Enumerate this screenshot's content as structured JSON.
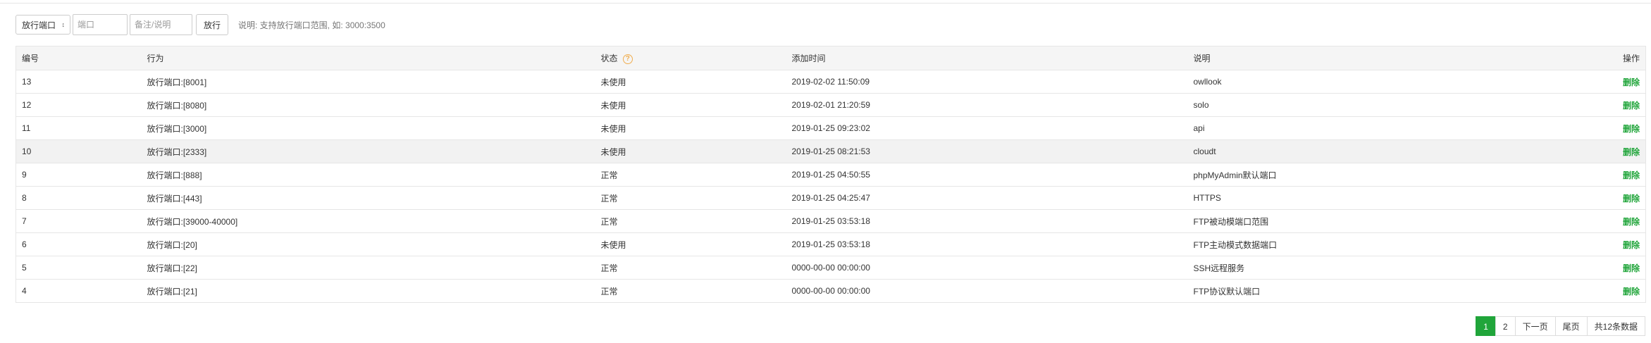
{
  "toolbar": {
    "select_value": "放行端口",
    "port_placeholder": "端口",
    "note_placeholder": "备注/说明",
    "submit_label": "放行",
    "hint": "说明: 支持放行端口范围, 如: 3000:3500"
  },
  "table": {
    "headers": {
      "id": "编号",
      "action": "行为",
      "status": "状态",
      "time": "添加时间",
      "desc": "说明",
      "op": "操作"
    },
    "status_help_icon": "question-circle-icon",
    "rows": [
      {
        "id": "13",
        "action": "放行端口:[8001]",
        "status": "未使用",
        "time": "2019-02-02 11:50:09",
        "desc": "owllook",
        "op": "删除"
      },
      {
        "id": "12",
        "action": "放行端口:[8080]",
        "status": "未使用",
        "time": "2019-02-01 21:20:59",
        "desc": "solo",
        "op": "删除"
      },
      {
        "id": "11",
        "action": "放行端口:[3000]",
        "status": "未使用",
        "time": "2019-01-25 09:23:02",
        "desc": "api",
        "op": "删除"
      },
      {
        "id": "10",
        "action": "放行端口:[2333]",
        "status": "未使用",
        "time": "2019-01-25 08:21:53",
        "desc": "cloudt",
        "op": "删除"
      },
      {
        "id": "9",
        "action": "放行端口:[888]",
        "status": "正常",
        "time": "2019-01-25 04:50:55",
        "desc": "phpMyAdmin默认端口",
        "op": "删除"
      },
      {
        "id": "8",
        "action": "放行端口:[443]",
        "status": "正常",
        "time": "2019-01-25 04:25:47",
        "desc": "HTTPS",
        "op": "删除"
      },
      {
        "id": "7",
        "action": "放行端口:[39000-40000]",
        "status": "正常",
        "time": "2019-01-25 03:53:18",
        "desc": "FTP被动模端口范围",
        "op": "删除"
      },
      {
        "id": "6",
        "action": "放行端口:[20]",
        "status": "未使用",
        "time": "2019-01-25 03:53:18",
        "desc": "FTP主动模式数据端口",
        "op": "删除"
      },
      {
        "id": "5",
        "action": "放行端口:[22]",
        "status": "正常",
        "time": "0000-00-00 00:00:00",
        "desc": "SSH远程服务",
        "op": "删除"
      },
      {
        "id": "4",
        "action": "放行端口:[21]",
        "status": "正常",
        "time": "0000-00-00 00:00:00",
        "desc": "FTP协议默认端口",
        "op": "删除"
      }
    ],
    "highlighted_row": "10"
  },
  "pagination": {
    "pages": [
      "1",
      "2"
    ],
    "current": "1",
    "next": "下一页",
    "last": "尾页",
    "total": "共12条数据"
  },
  "colors": {
    "accent": "#20a53a",
    "help_icon": "#f0ad4e"
  }
}
